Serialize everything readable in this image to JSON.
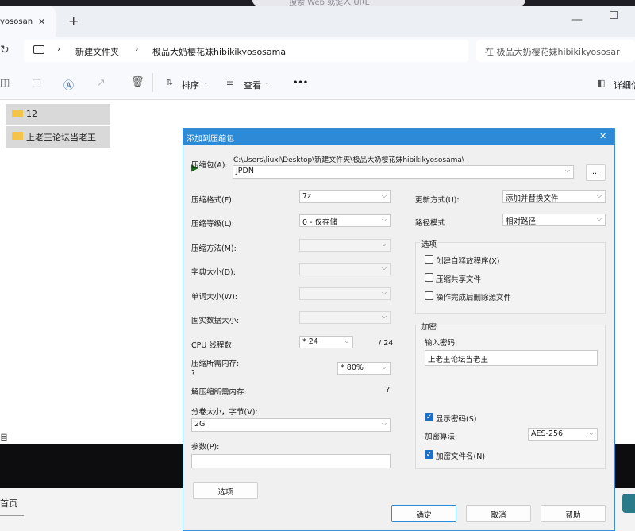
{
  "browser": {
    "address_placeholder": "搜索 Web 或键入 URL",
    "new_tab_label": "+"
  },
  "explorer": {
    "tab_title": "yososan",
    "tab_close": "✕",
    "breadcrumb": [
      "新建文件夹",
      "极品大奶樱花妹hibikikyososama"
    ],
    "search_placeholder": "在 极品大奶樱花妹hibikikyososar",
    "toolbar": {
      "sort_label": "排序",
      "view_label": "查看",
      "more_label": "•••",
      "details_label": "详细信"
    },
    "files": [
      "12",
      "上老王论坛当老王"
    ],
    "left_edge_text": "目",
    "home_tab": "首页"
  },
  "dialog": {
    "title": "添加到压缩包",
    "close_label": "✕",
    "archive_label": "压缩包(A):",
    "archive_path": "C:\\Users\\liuxl\\Desktop\\新建文件夹\\极品大奶樱花妹hibikikyososama\\",
    "archive_name": "JPDN",
    "browse_label": "...",
    "format_label": "压缩格式(F):",
    "format_value": "7z",
    "level_label": "压缩等级(L):",
    "level_value": "0 - 仅存储",
    "method_label": "压缩方法(M):",
    "dict_label": "字典大小(D):",
    "word_label": "单词大小(W):",
    "solid_label": "固实数据大小:",
    "cpu_label": "CPU 线程数:",
    "cpu_value": "* 24",
    "cpu_total": "/ 24",
    "mem_label": "压缩所需内存:",
    "mem_value_placeholder": "?",
    "mem_percent": "* 80%",
    "decomp_label": "解压缩所需内存:",
    "decomp_value": "?",
    "volume_label": "分卷大小，字节(V):",
    "volume_value": "2G",
    "params_label": "参数(P):",
    "params_value": "",
    "options_button": "选项",
    "update_label": "更新方式(U):",
    "update_value": "添加并替换文件",
    "path_label": "路径模式",
    "path_value": "相对路径",
    "options_group": "选项",
    "opt_sfx": "创建自释放程序(X)",
    "opt_shared": "压缩共享文件",
    "opt_delete": "操作完成后删除源文件",
    "encrypt_group": "加密",
    "password_label": "输入密码:",
    "password_value": "上老王论坛当老王",
    "show_password": "显示密码(S)",
    "enc_method_label": "加密算法:",
    "enc_method_value": "AES-256",
    "enc_names": "加密文件名(N)",
    "ok_button": "确定",
    "cancel_button": "取消",
    "help_button": "帮助"
  }
}
